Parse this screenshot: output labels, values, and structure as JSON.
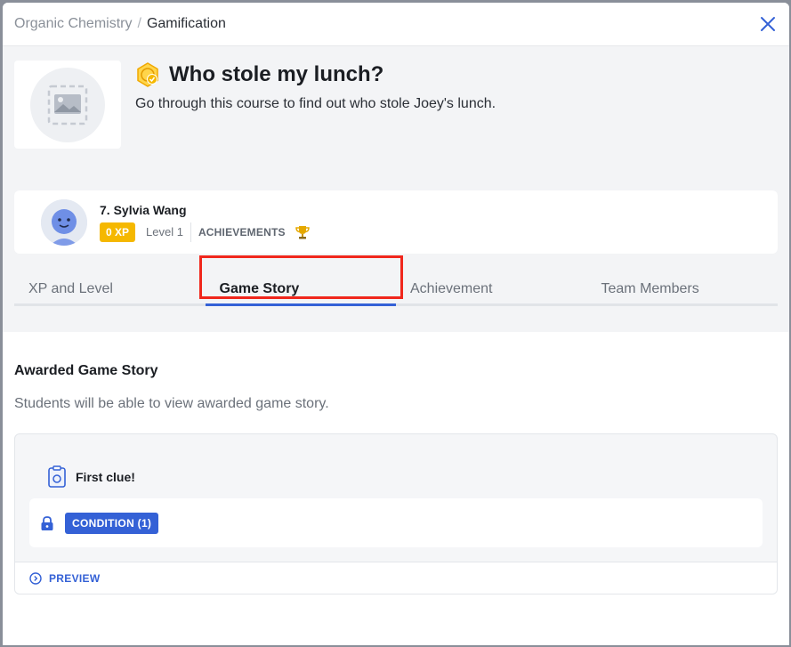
{
  "header": {
    "breadcrumb_parent": "Organic Chemistry",
    "breadcrumb_separator": "/",
    "breadcrumb_current": "Gamification",
    "close_icon": "close-icon"
  },
  "course": {
    "title": "Who stole my lunch?",
    "description": "Go through this course to find out who stole Joey's lunch.",
    "badge_icon": "game-story-badge-icon",
    "thumbnail_icon": "image-placeholder-icon"
  },
  "user": {
    "name": "7. Sylvia Wang",
    "xp": "0 XP",
    "level": "Level 1",
    "achievements_label": "ACHIEVEMENTS",
    "trophy_icon": "trophy-icon"
  },
  "tabs": [
    {
      "label": "XP and Level",
      "active": false
    },
    {
      "label": "Game Story",
      "active": true
    },
    {
      "label": "Achievement",
      "active": false
    },
    {
      "label": "Team Members",
      "active": false
    }
  ],
  "section": {
    "title": "Awarded Game Story",
    "description": "Students will be able to view awarded game story."
  },
  "story": {
    "name": "First clue!",
    "condition_label": "CONDITION (1)",
    "preview_label": "PREVIEW"
  },
  "colors": {
    "accent": "#3461d6",
    "xp_badge": "#f5b800",
    "highlight": "#f0271c",
    "background": "#f3f4f6"
  }
}
